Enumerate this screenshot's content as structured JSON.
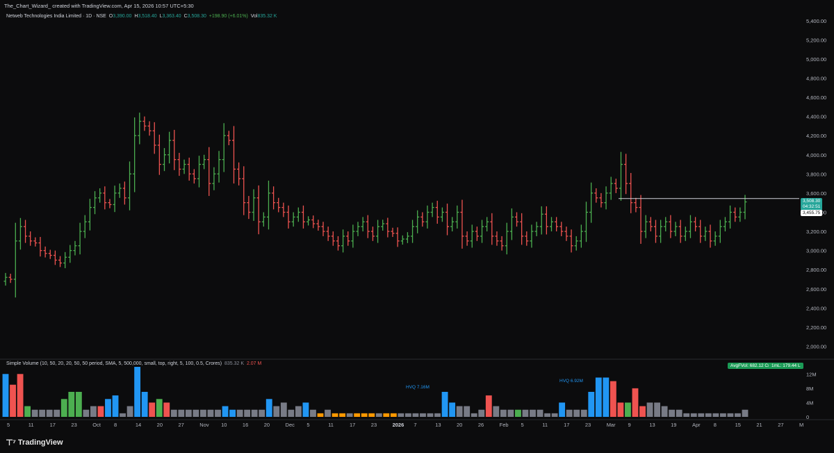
{
  "header": {
    "attribution": "The_Chart_Wizard_ created with TradingView.com, Apr 15, 2026 10:57 UTC+5:30"
  },
  "legend": {
    "symbol": "Netweb Technologies India Limited · 1D · NSE",
    "o_label": "O",
    "o_value": "3,390.00",
    "h_label": "H",
    "h_value": "3,518.40",
    "l_label": "L",
    "l_value": "3,363.40",
    "c_label": "C",
    "c_value": "3,508.30",
    "change": "+198.90 (+6.01%)",
    "vol_label": "Vol",
    "vol_value": "835.32 K"
  },
  "volume_legend": {
    "title": "Simple Volume (10, 50, 20, 20, 50, 50 period, SMA, 5, 500,000, small, top, right, 5, 100, 0.5, Crores)",
    "value1": "835.32 K",
    "value2": "2.07 M"
  },
  "badges": {
    "last_price": "3,508.30",
    "countdown": "04:32:51",
    "level": "3,455.75",
    "avg_f_vol": "AvgFVol: 682.12 Cr",
    "avg_vol": "1mL: 179.44 L"
  },
  "annotations": {
    "hvq1": "HVQ 7.16M",
    "hvq2": "HVQ 6.92M"
  },
  "footer": {
    "brand": "TradingView"
  },
  "colors": {
    "up": "#4caf50",
    "down": "#ef5350",
    "hvq": "#2196f3",
    "neutral": "#787b86",
    "low": "#ff9800",
    "bg": "#0c0c0d"
  },
  "chart_data": {
    "type": "ohlc",
    "price_axis": {
      "ticks": [
        "5,400.00",
        "5,200.00",
        "5,000.00",
        "4,800.00",
        "4,600.00",
        "4,400.00",
        "4,200.00",
        "4,000.00",
        "3,800.00",
        "3,600.00",
        "3,400.00",
        "3,200.00",
        "3,000.00",
        "2,800.00",
        "2,600.00",
        "2,400.00",
        "2,200.00",
        "2,000.00"
      ],
      "ylim": [
        1880,
        5500
      ]
    },
    "volume_axis": {
      "ticks": [
        "12M",
        "8M",
        "4M",
        "0"
      ],
      "ylim": [
        0,
        14
      ]
    },
    "x_labels": [
      "5",
      "11",
      "17",
      "23",
      "Oct",
      "8",
      "14",
      "20",
      "27",
      "Nov",
      "10",
      "16",
      "20",
      "Dec",
      "5",
      "11",
      "17",
      "23",
      "2026",
      "7",
      "13",
      "20",
      "26",
      "Feb",
      "5",
      "11",
      "17",
      "23",
      "Mar",
      "9",
      "13",
      "19",
      "Apr",
      "8",
      "15",
      "21",
      "27",
      "M"
    ],
    "horizontal_level": 3455.75,
    "closes": [
      2720,
      2700,
      3100,
      3250,
      3150,
      3100,
      3080,
      3000,
      2970,
      2950,
      2900,
      2870,
      2930,
      3000,
      3050,
      3200,
      3300,
      3450,
      3550,
      3600,
      3500,
      3480,
      3600,
      3650,
      3550,
      3800,
      4200,
      4350,
      4300,
      4250,
      4100,
      3900,
      4000,
      4150,
      3950,
      3850,
      3900,
      3800,
      3750,
      3900,
      3950,
      3700,
      3800,
      3950,
      4200,
      4150,
      3850,
      3750,
      3500,
      3400,
      3550,
      3300,
      3350,
      3600,
      3500,
      3450,
      3400,
      3300,
      3350,
      3400,
      3300,
      3320,
      3280,
      3250,
      3200,
      3150,
      3100,
      3050,
      3150,
      3100,
      3200,
      3250,
      3300,
      3200,
      3150,
      3250,
      3280,
      3200,
      3180,
      3100,
      3120,
      3150,
      3250,
      3350,
      3300,
      3400,
      3450,
      3350,
      3400,
      3250,
      3300,
      3400,
      3150,
      3100,
      3200,
      3150,
      3250,
      3300,
      3150,
      3100,
      3050,
      3200,
      3350,
      3300,
      3150,
      3100,
      3200,
      3250,
      3380,
      3250,
      3300,
      3250,
      3200,
      3150,
      3050,
      3100,
      3200,
      3400,
      3600,
      3550,
      3500,
      3600,
      3700,
      3650,
      3900,
      3700,
      3500,
      3450,
      3200,
      3300,
      3250,
      3150,
      3250,
      3300,
      3200,
      3250,
      3150,
      3200,
      3300,
      3250,
      3150,
      3200,
      3100,
      3150,
      3250,
      3300,
      3400,
      3350,
      3400,
      3508
    ],
    "volumes": [
      12,
      9,
      12,
      3,
      2,
      2,
      2,
      2,
      5,
      7,
      7,
      2,
      3,
      3,
      5,
      6,
      1,
      3,
      14,
      7,
      4,
      5,
      4,
      2,
      2,
      2,
      2,
      2,
      2,
      2,
      3,
      2,
      2,
      2,
      2,
      2,
      5,
      3,
      4,
      2,
      3,
      4,
      2,
      1,
      2,
      1,
      1,
      1,
      1,
      1,
      1,
      1,
      1,
      1,
      1,
      1,
      1,
      1,
      1,
      1,
      7,
      4,
      3,
      3,
      1,
      2,
      6,
      3,
      2,
      2,
      2,
      2,
      2,
      2,
      1,
      1,
      4,
      2,
      2,
      2,
      7,
      11,
      11,
      10,
      4,
      4,
      8,
      3,
      4,
      4,
      3,
      2,
      2,
      1,
      1,
      1,
      1,
      1,
      1,
      1,
      1,
      2
    ],
    "volume_colors": [
      "blue",
      "red",
      "red",
      "green",
      "grey",
      "grey",
      "grey",
      "grey",
      "green",
      "green",
      "green",
      "grey",
      "grey",
      "red",
      "blue",
      "blue",
      "grey",
      "grey",
      "blue",
      "blue",
      "red",
      "green",
      "red",
      "grey",
      "grey",
      "grey",
      "grey",
      "grey",
      "grey",
      "grey",
      "blue",
      "blue",
      "grey",
      "grey",
      "grey",
      "grey",
      "blue",
      "grey",
      "grey",
      "grey",
      "grey",
      "blue",
      "grey",
      "orange",
      "grey",
      "orange",
      "orange",
      "grey",
      "orange",
      "orange",
      "orange",
      "grey",
      "orange",
      "orange",
      "grey",
      "grey",
      "grey",
      "grey",
      "grey",
      "grey",
      "blue",
      "blue",
      "grey",
      "grey",
      "grey",
      "grey",
      "red",
      "grey",
      "grey",
      "grey",
      "green",
      "grey",
      "grey",
      "grey",
      "grey",
      "grey",
      "blue",
      "grey",
      "grey",
      "grey",
      "blue",
      "blue",
      "blue",
      "red",
      "red",
      "green",
      "red",
      "red",
      "grey",
      "grey",
      "grey",
      "grey",
      "grey",
      "grey",
      "grey",
      "grey",
      "grey",
      "grey",
      "grey",
      "grey",
      "grey",
      "grey"
    ]
  }
}
